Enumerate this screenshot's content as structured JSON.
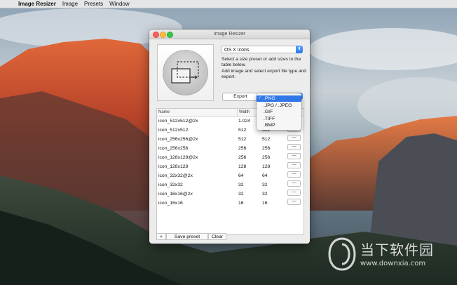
{
  "menubar": {
    "apple_icon": "",
    "app_name": "Image Resizer",
    "items": [
      "Image",
      "Presets",
      "Window"
    ]
  },
  "window": {
    "title": "Image Resizer",
    "preset": {
      "selected": "OS X Icons",
      "arrow_icon": "updown-chevron-icon"
    },
    "help_text": "Select a size preset or add sizes to the table below.\nAdd image and select export file type and export.",
    "export_label": "Export",
    "format_dropdown": {
      "options": [
        ".PNG",
        ".JPG / .JPEG",
        ".GIF",
        ".TIFF",
        ".BMP"
      ],
      "selected_index": 0,
      "check_mark": "✓"
    },
    "table": {
      "headers": {
        "name": "Name",
        "width": "Width"
      },
      "row_button": "—",
      "rows": [
        {
          "name": "icon_512x512@2x",
          "width": "1.024",
          "height": ""
        },
        {
          "name": "icon_512x512",
          "width": "512",
          "height": "512"
        },
        {
          "name": "icon_256x256@2x",
          "width": "512",
          "height": "512"
        },
        {
          "name": "icon_256x256",
          "width": "256",
          "height": "256"
        },
        {
          "name": "icon_128x128@2x",
          "width": "256",
          "height": "256"
        },
        {
          "name": "icon_128x128",
          "width": "128",
          "height": "128"
        },
        {
          "name": "icon_32x32@2x",
          "width": "64",
          "height": "64"
        },
        {
          "name": "icon_32x32",
          "width": "32",
          "height": "32"
        },
        {
          "name": "icon_16x16@2x",
          "width": "32",
          "height": "32"
        },
        {
          "name": "icon_16x16",
          "width": "16",
          "height": "16"
        }
      ]
    },
    "bottom_bar": {
      "add_label": "+",
      "save_label": "Save preset",
      "clear_label": "Clear"
    }
  },
  "watermark": {
    "text": "当下软件园",
    "url": "www.downxia.com"
  },
  "colors": {
    "accent": "#2f77e8",
    "close": "#fc605c",
    "minimize": "#fdbc40",
    "maximize": "#34c84a"
  }
}
